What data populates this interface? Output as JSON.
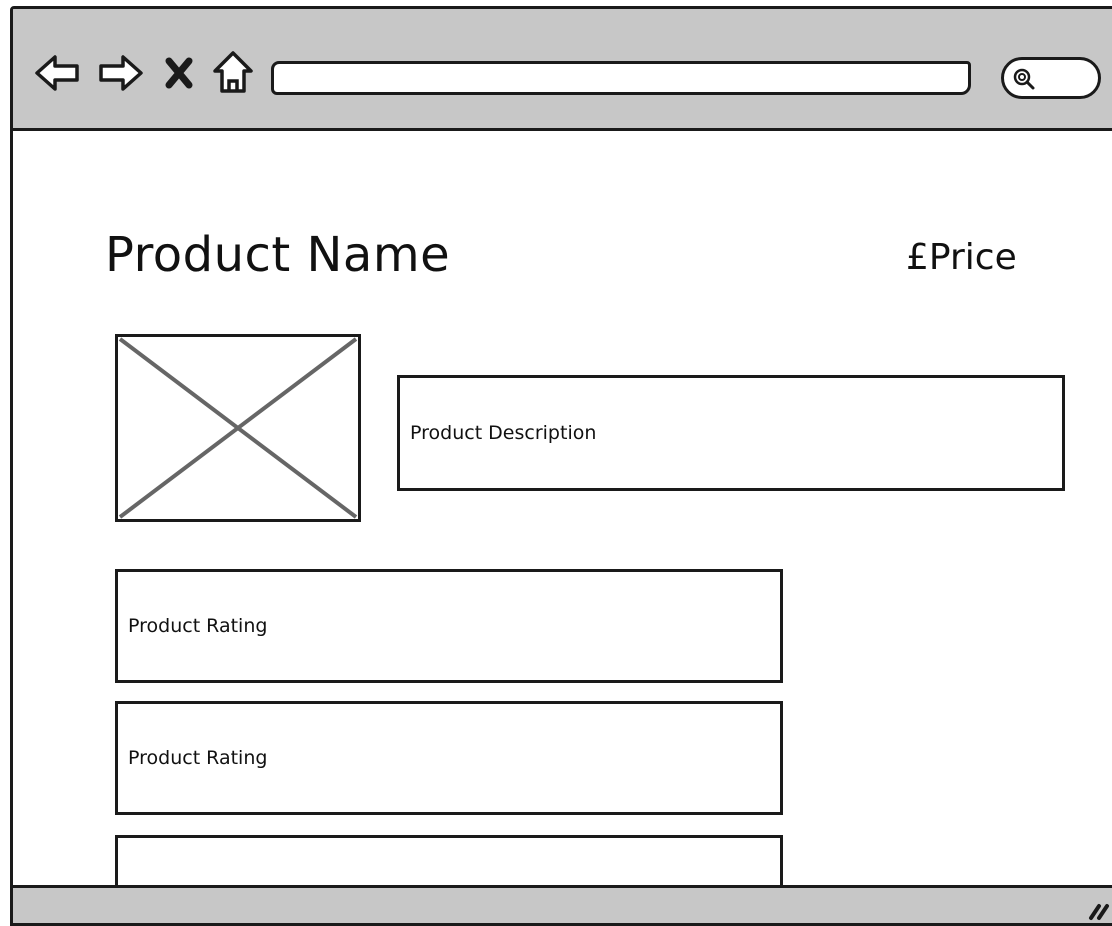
{
  "browser": {
    "address_bar": {
      "value": "",
      "placeholder": ""
    },
    "search": {
      "value": "",
      "placeholder": ""
    },
    "icons": {
      "back": "back-arrow-icon",
      "forward": "forward-arrow-icon",
      "stop": "close-icon",
      "home": "home-icon",
      "search": "search-icon",
      "resize": "resize-grip-icon"
    }
  },
  "product": {
    "name": "Product Name",
    "price": "£Price",
    "image": "image-placeholder",
    "description_label": "Product Description",
    "ratings": [
      {
        "label": "Product Rating"
      },
      {
        "label": "Product Rating"
      },
      {
        "label": ""
      }
    ]
  },
  "colors": {
    "chrome": "#c7c7c7",
    "stroke": "#1a1a1a",
    "placeholder_x": "#666666"
  }
}
